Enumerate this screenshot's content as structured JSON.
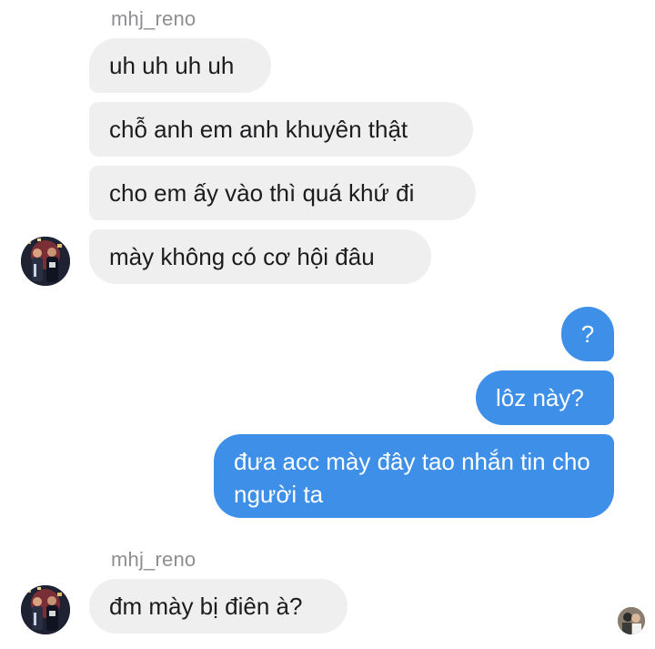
{
  "conversation": {
    "groups": [
      {
        "sender": "mhj_reno",
        "messages": [
          "uh uh uh uh",
          "chỗ anh em anh khuyên thật",
          "cho em ấy vào thì quá khứ đi",
          "mày không có cơ hội đâu"
        ]
      },
      {
        "sender": "mhj_reno",
        "messages": [
          "đm mày bị điên à?"
        ]
      }
    ],
    "outgoing": [
      "?",
      "lôz này?",
      "đưa acc mày đây tao nhắn tin cho người ta"
    ]
  },
  "icons": {
    "contact_avatar": "contact-avatar-icon",
    "seen_avatar": "seen-receipt-avatar-icon"
  },
  "colors": {
    "incoming_bubble": "#efeff0",
    "outgoing_bubble": "#3d8fe8",
    "sender_name": "#8e8e93"
  }
}
